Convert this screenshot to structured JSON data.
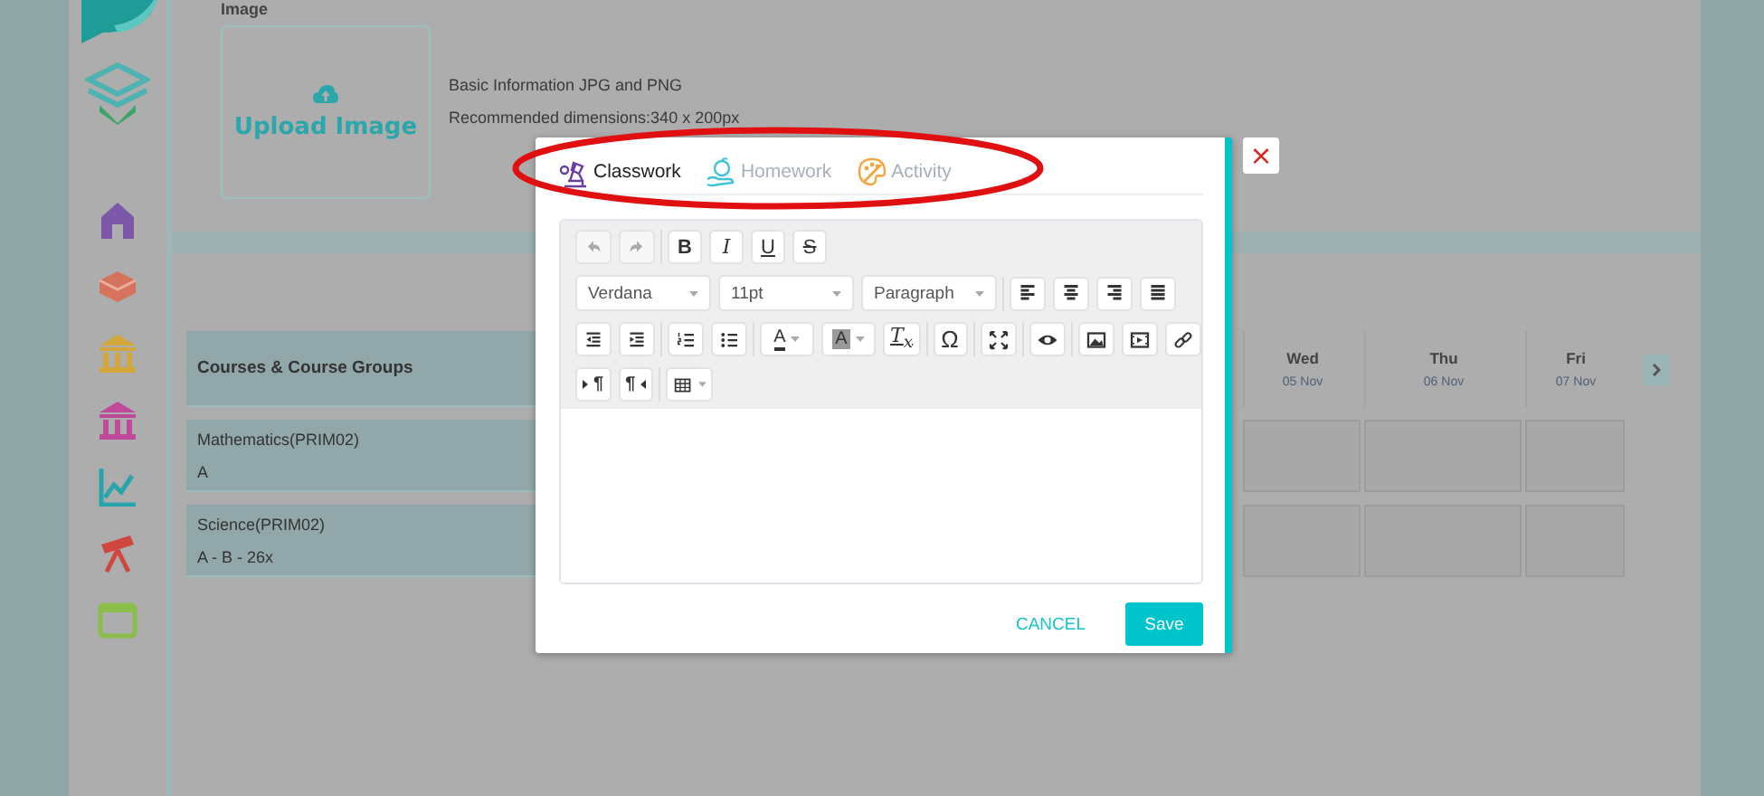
{
  "sidebar": {
    "items": [
      {
        "kind": "house",
        "color": "#7d58a8"
      },
      {
        "kind": "stack",
        "color": "#d5735e"
      },
      {
        "kind": "building",
        "color": "#d4a73c"
      },
      {
        "kind": "building",
        "color": "#c04a9a"
      },
      {
        "kind": "chart",
        "color": "#2aa4ab"
      },
      {
        "kind": "telescope",
        "color": "#d0473f"
      },
      {
        "kind": "calendar",
        "color": "#8bbd4a"
      }
    ]
  },
  "image_section": {
    "label": "Image",
    "upload_label": "Upload Image",
    "info": [
      "Basic Information JPG and PNG",
      "Recommended dimensions:340 x 200px"
    ]
  },
  "schedule": {
    "header": "Courses & Course Groups",
    "days": [
      {
        "name": "Wed",
        "date": "05 Nov"
      },
      {
        "name": "Thu",
        "date": "06 Nov"
      },
      {
        "name": "Fri",
        "date": "07 Nov"
      }
    ],
    "rows": [
      {
        "course": "Mathematics(PRIM02)",
        "groups": "A"
      },
      {
        "course": "Science(PRIM02)",
        "groups": "A - B - 26x"
      }
    ]
  },
  "modal": {
    "tabs": [
      {
        "label": "Classwork",
        "selected": true,
        "color": "#6a3fa0"
      },
      {
        "label": "Homework",
        "selected": false,
        "color": "#3cc4d4"
      },
      {
        "label": "Activity",
        "selected": false,
        "color": "#f4a640"
      }
    ],
    "toolbar": [
      [
        [
          {
            "kind": "undo",
            "disabled": true
          },
          {
            "kind": "redo",
            "disabled": true
          }
        ],
        [
          {
            "kind": "bold",
            "label": "B",
            "disabled": false
          },
          {
            "kind": "italic",
            "label": "I",
            "disabled": false
          },
          {
            "kind": "underline",
            "label": "U",
            "disabled": false
          },
          {
            "kind": "strike",
            "label": "S",
            "disabled": false
          }
        ]
      ],
      [
        [
          {
            "kind": "select",
            "label": "Verdana",
            "disabled": false
          },
          {
            "kind": "select",
            "label": "11pt",
            "disabled": false
          },
          {
            "kind": "select",
            "label": "Paragraph",
            "disabled": false
          }
        ],
        [
          {
            "kind": "align-left",
            "disabled": false
          },
          {
            "kind": "align-center",
            "disabled": false
          },
          {
            "kind": "align-right",
            "disabled": false
          },
          {
            "kind": "align-justify",
            "disabled": false
          }
        ]
      ],
      [
        [
          {
            "kind": "outdent",
            "disabled": false
          },
          {
            "kind": "indent",
            "disabled": false
          }
        ],
        [
          {
            "kind": "ordered-list",
            "disabled": false
          },
          {
            "kind": "bullet-list",
            "disabled": false
          }
        ],
        [
          {
            "kind": "font-color",
            "label": "A",
            "disabled": false
          },
          {
            "kind": "back-color",
            "label": "A",
            "disabled": false
          },
          {
            "kind": "clear-format",
            "label": "T$_{x}$",
            "disabled": false
          }
        ],
        [
          {
            "kind": "glyph",
            "label": "Ω",
            "disabled": false
          }
        ],
        [
          {
            "kind": "fullscreen",
            "disabled": false
          }
        ],
        [
          {
            "kind": "preview",
            "disabled": false
          }
        ],
        [
          {
            "kind": "image",
            "disabled": false
          },
          {
            "kind": "media",
            "disabled": false
          },
          {
            "kind": "link",
            "disabled": false
          }
        ]
      ],
      [
        [
          {
            "kind": "ltr",
            "label": "¶",
            "disabled": false
          },
          {
            "kind": "rtl",
            "label": "¶",
            "disabled": false
          }
        ],
        [
          {
            "kind": "table",
            "disabled": false
          }
        ]
      ]
    ],
    "cancel": "CANCEL",
    "save": "Save",
    "close": "×"
  }
}
